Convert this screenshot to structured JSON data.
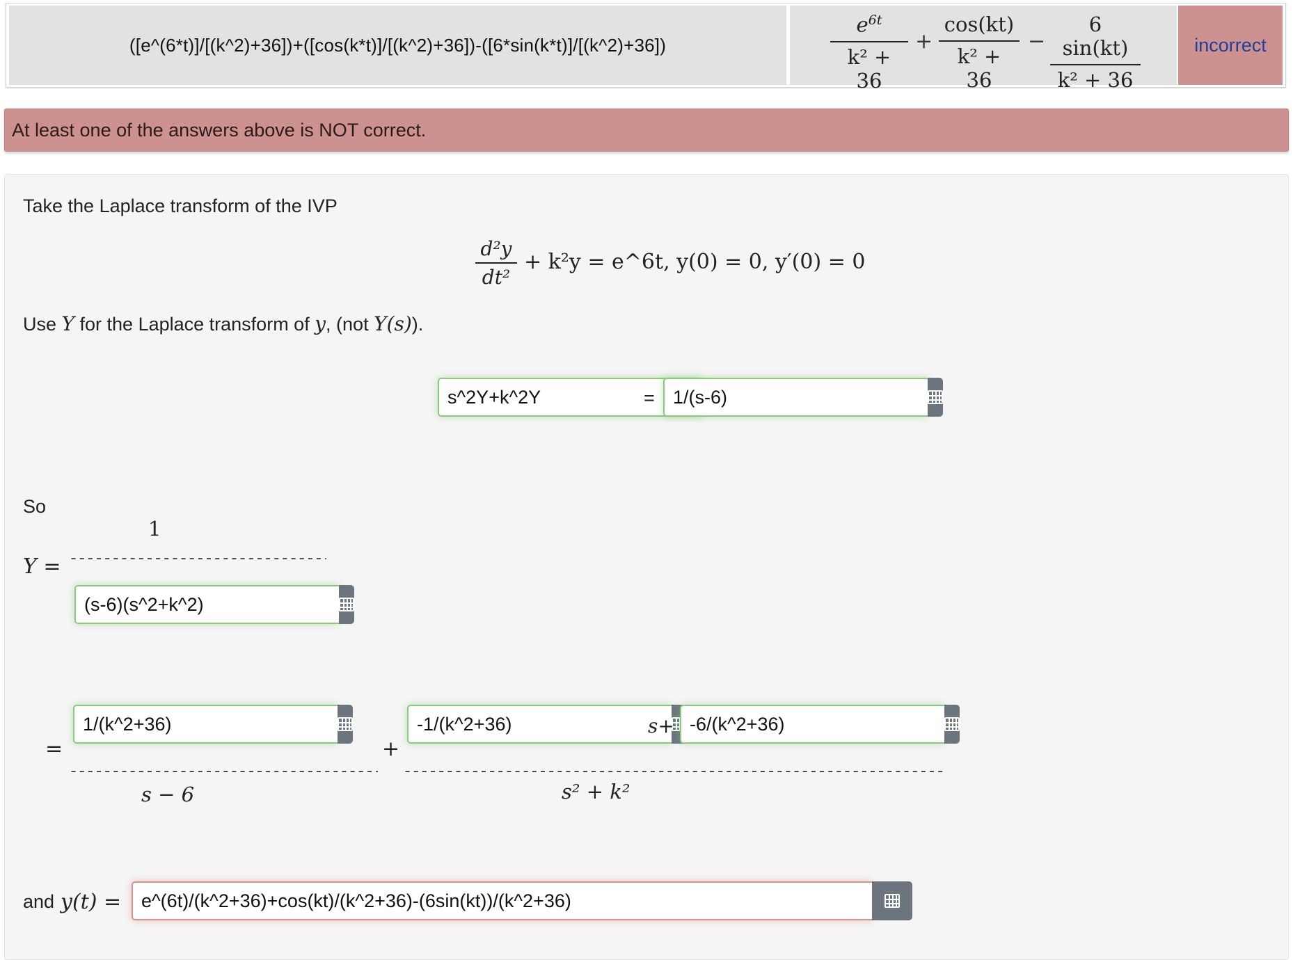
{
  "results": {
    "entered": "([e^(6*t)]/[(k^2)+36])+([cos(k*t)]/[(k^2)+36])-([6*sin(k*t)]/[(k^2)+36])",
    "preview": {
      "term1_num": "e^6t",
      "term2_num": "cos(kt)",
      "term3_num": "6 sin(kt)",
      "den": "k² + 36",
      "op1": "+",
      "op2": "−"
    },
    "status": "incorrect"
  },
  "alert": {
    "message": "At least one of the answers above is NOT correct."
  },
  "problem": {
    "intro": "Take the Laplace transform of the IVP",
    "equation": {
      "num": "d²y",
      "den": "dt²",
      "rest": "+ k²y = e^6t, y(0) = 0, y′(0) = 0"
    },
    "note_prefix": "Use",
    "note_Y": "Y",
    "note_mid": "for the Laplace transform of",
    "note_y": "y",
    "note_suffix": ", (not",
    "note_Ys": "Y(s)",
    "note_end": ").",
    "lhs_value": "s^2Y+k^2Y",
    "equals": "=",
    "rhs_value": "1/(s-6)",
    "so_label": "So",
    "Y_label": "Y =",
    "Y_numerator": "1",
    "Y_denominator_value": "(s-6)(s^2+k^2)",
    "eq2_label": "=",
    "pf_A_value": "1/(k^2+36)",
    "pf_A_den": "s − 6",
    "plus": "+",
    "pf_B_value": "-1/(k^2+36)",
    "pf_s_plus": "s+",
    "pf_C_value": "-6/(k^2+36)",
    "pf_BC_den": "s² + k²",
    "and_label": "and",
    "yt_label": "y(t) =",
    "yt_value": "e^(6t)/(k^2+36)+cos(kt)/(k^2+36)-(6sin(kt))/(k^2+36)"
  },
  "icons": {
    "equation_editor": "grid-icon"
  },
  "colors": {
    "incorrect_bg": "#cd9290",
    "correct_border": "#8cc97e",
    "incorrect_border": "#d9918f",
    "editor_button": "#6c757d"
  }
}
